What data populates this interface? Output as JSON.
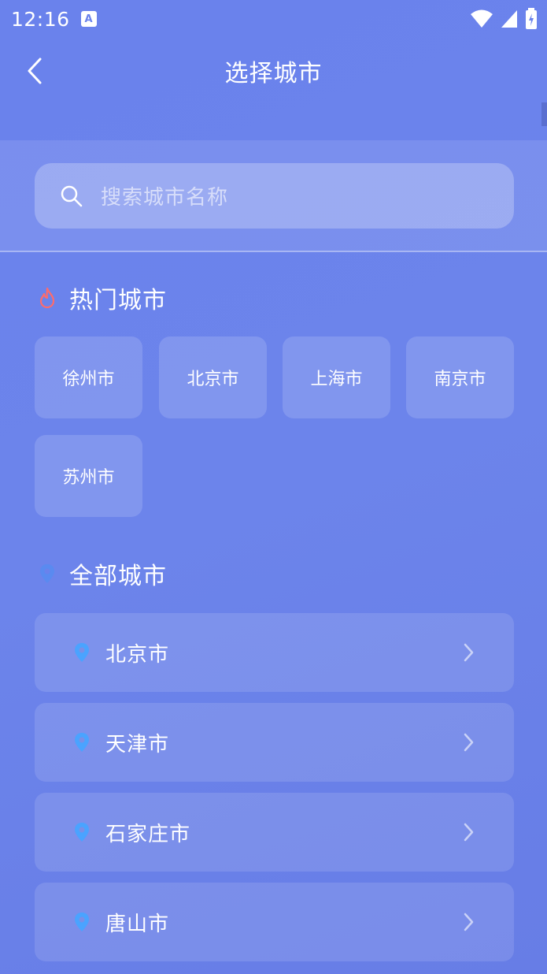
{
  "status_bar": {
    "time": "12:16",
    "notification_icon": "A"
  },
  "nav": {
    "title": "选择城市"
  },
  "search": {
    "placeholder": "搜索城市名称"
  },
  "hot_section": {
    "label": "热门城市",
    "cities": [
      "徐州市",
      "北京市",
      "上海市",
      "南京市",
      "苏州市"
    ]
  },
  "all_section": {
    "label": "全部城市",
    "cities": [
      "北京市",
      "天津市",
      "石家庄市",
      "唐山市"
    ]
  },
  "colors": {
    "background": "#6a82ec",
    "fire_icon": "#ff6b6b",
    "pin_icon": "#4aa3ff"
  }
}
